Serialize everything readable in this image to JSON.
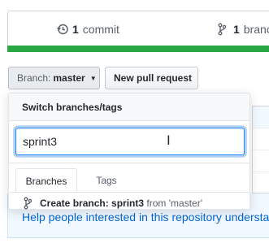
{
  "summary": {
    "commits_count": "1",
    "commits_label": "commit",
    "branches_count": "1",
    "branches_label": "branch"
  },
  "toolbar": {
    "branch_prefix": "Branch:",
    "branch_name": "master",
    "new_pr_label": "New pull request"
  },
  "branch_dropdown": {
    "header": "Switch branches/tags",
    "filter_value": "sprint3",
    "tabs": [
      "Branches",
      "Tags"
    ],
    "create_label": "Create branch:",
    "create_name": "sprint3",
    "create_from": "from 'master'"
  },
  "readme_banner": {
    "text": "Help people interested in this repository understand"
  },
  "colors": {
    "accent_green": "#28a745",
    "focus_blue": "#2188ff",
    "banner_bg": "#f1f8ff"
  }
}
